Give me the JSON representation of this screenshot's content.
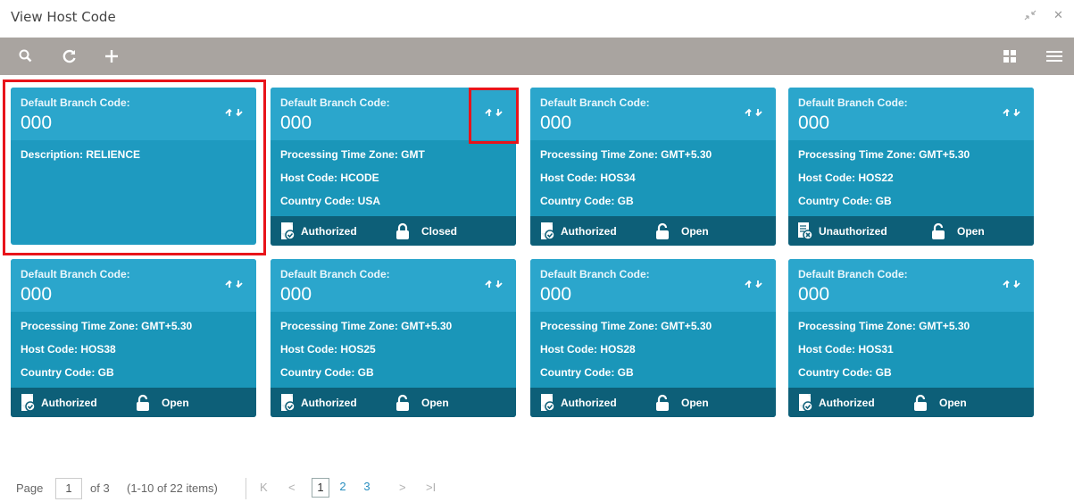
{
  "window": {
    "title": "View Host Code",
    "shrink_icon": "shrink-icon",
    "close_icon": "close-icon",
    "close_glyph": "✕"
  },
  "toolbar": {
    "search_icon": "search-icon",
    "refresh_icon": "refresh-icon",
    "add_icon": "add-icon",
    "grid_view_icon": "grid-view-icon",
    "list_view_icon": "list-view-icon"
  },
  "colors": {
    "toolbar_bg": "#a9a4a0",
    "card_header": "#2ba6cc",
    "card_body": "#1a96b9",
    "card_footer": "#0d5f78",
    "highlight": "#e8141a"
  },
  "cards": [
    {
      "label": "Default Branch Code:",
      "code": "000",
      "fields": [
        "Description: RELIENCE"
      ],
      "auth_status": "",
      "record_status": "",
      "selected": true
    },
    {
      "label": "Default Branch Code:",
      "code": "000",
      "fields": [
        "Processing Time Zone: GMT",
        "Host Code: HCODE",
        "Country Code: USA"
      ],
      "auth_status": "Authorized",
      "record_status": "Closed"
    },
    {
      "label": "Default Branch Code:",
      "code": "000",
      "fields": [
        "Processing Time Zone: GMT+5.30",
        "Host Code: HOS34",
        "Country Code: GB"
      ],
      "auth_status": "Authorized",
      "record_status": "Open"
    },
    {
      "label": "Default Branch Code:",
      "code": "000",
      "fields": [
        "Processing Time Zone: GMT+5.30",
        "Host Code: HOS22",
        "Country Code: GB"
      ],
      "auth_status": "Unauthorized",
      "record_status": "Open"
    },
    {
      "label": "Default Branch Code:",
      "code": "000",
      "fields": [
        "Processing Time Zone: GMT+5.30",
        "Host Code: HOS38",
        "Country Code: GB"
      ],
      "auth_status": "Authorized",
      "record_status": "Open"
    },
    {
      "label": "Default Branch Code:",
      "code": "000",
      "fields": [
        "Processing Time Zone: GMT+5.30",
        "Host Code: HOS25",
        "Country Code: GB"
      ],
      "auth_status": "Authorized",
      "record_status": "Open"
    },
    {
      "label": "Default Branch Code:",
      "code": "000",
      "fields": [
        "Processing Time Zone: GMT+5.30",
        "Host Code: HOS28",
        "Country Code: GB"
      ],
      "auth_status": "Authorized",
      "record_status": "Open"
    },
    {
      "label": "Default Branch Code:",
      "code": "000",
      "fields": [
        "Processing Time Zone: GMT+5.30",
        "Host Code: HOS31",
        "Country Code: GB"
      ],
      "auth_status": "Authorized",
      "record_status": "Open"
    }
  ],
  "pagination": {
    "page_label": "Page",
    "current_page": "1",
    "of_text": "of 3",
    "items_text": "(1-10 of 22 items)",
    "first_glyph": "K",
    "prev_glyph": "<",
    "next_glyph": ">",
    "last_glyph": ">I",
    "pages": [
      "1",
      "2",
      "3"
    ]
  }
}
